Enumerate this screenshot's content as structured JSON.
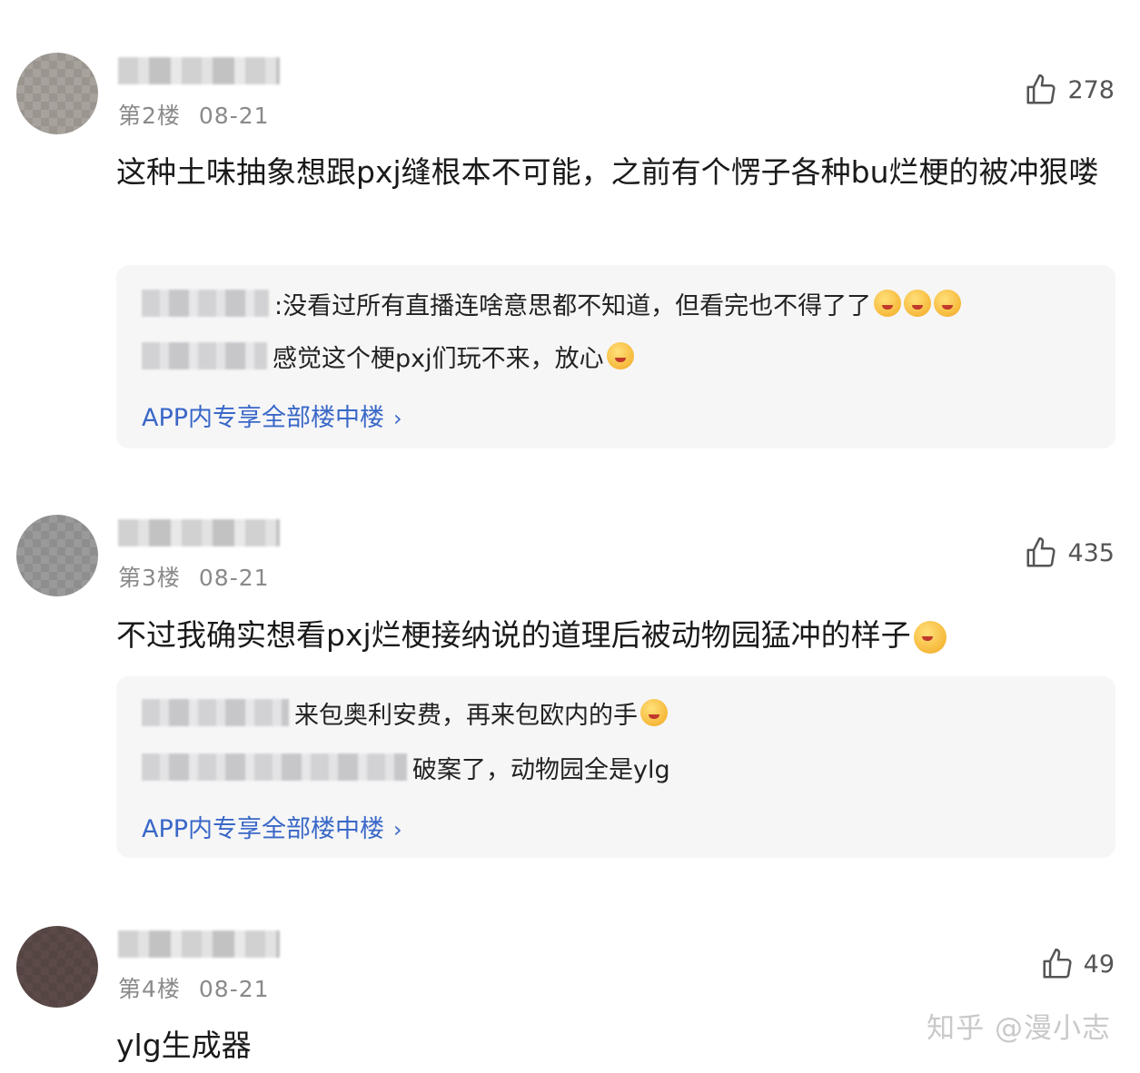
{
  "comments": [
    {
      "floor": "第2楼",
      "date": "08-21",
      "likes": "278",
      "text": "这种土味抽象想跟pxj缝根本不可能，之前有个愣子各种bu烂梗的被冲狠喽",
      "replies": [
        {
          "text": ":没看过所有直播连啥意思都不知道，但看完也不得了了"
        },
        {
          "text": "感觉这个梗pxj们玩不来，放心"
        }
      ],
      "more_link": "APP内专享全部楼中楼"
    },
    {
      "floor": "第3楼",
      "date": "08-21",
      "likes": "435",
      "text": "不过我确实想看pxj烂梗接纳说的道理后被动物园猛冲的样子",
      "replies": [
        {
          "text": "来包奥利安费，再来包欧内的手"
        },
        {
          "text": "破案了，动物园全是ylg"
        }
      ],
      "more_link": "APP内专享全部楼中楼"
    },
    {
      "floor": "第4楼",
      "date": "08-21",
      "likes": "49",
      "text": "ylg生成器"
    }
  ],
  "watermark": "知乎 @漫小志",
  "icons": {
    "like": "thumbs-up-icon",
    "chevron": "chevron-right-icon",
    "emoji": "emoji-icon"
  },
  "colors": {
    "link": "#3a68c8",
    "meta": "#8a8a8a",
    "reply_bg": "#f6f6f7"
  }
}
